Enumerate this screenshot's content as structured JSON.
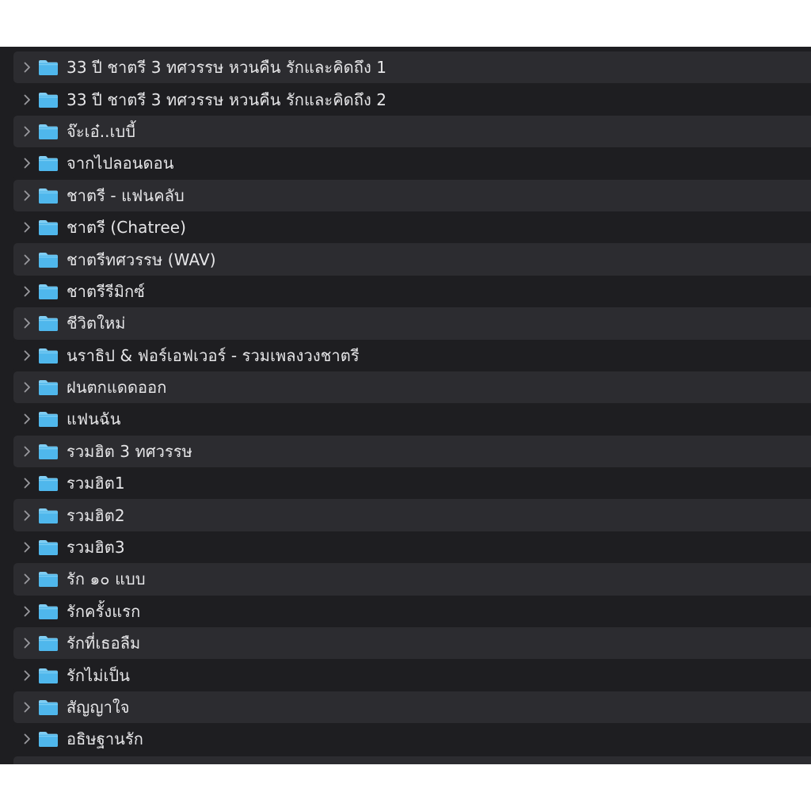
{
  "colors": {
    "window_bg": "#1e1e21",
    "row_alt_bg": "#2c2c30",
    "text": "#e6e6e8",
    "chevron": "#9a9a9f",
    "folder_body": "#4fb7ec",
    "folder_tab": "#7fcdf3"
  },
  "icons": {
    "disclosure": "chevron-right-icon",
    "item": "folder-icon"
  },
  "folders": [
    {
      "name": "33 ปี ชาตรี 3 ทศวรรษ หวนคืน รักและคิดถึง 1"
    },
    {
      "name": "33 ปี ชาตรี 3 ทศวรรษ หวนคืน รักและคิดถึง 2"
    },
    {
      "name": "จ๊ะเอ๋..เบบี้"
    },
    {
      "name": "จากไปลอนดอน"
    },
    {
      "name": "ชาตรี - แฟนคลับ"
    },
    {
      "name": "ชาตรี (Chatree)"
    },
    {
      "name": "ชาตรีทศวรรษ (WAV)"
    },
    {
      "name": "ชาตรีรีมิกซ์"
    },
    {
      "name": "ชีวิตใหม่"
    },
    {
      "name": "นราธิป & ฟอร์เอฟเวอร์ - รวมเพลงวงชาตรี"
    },
    {
      "name": "ฝนตกแดดออก"
    },
    {
      "name": "แฟนฉัน"
    },
    {
      "name": "รวมฮิต 3 ทศวรรษ"
    },
    {
      "name": "รวมฮิต1"
    },
    {
      "name": "รวมฮิต2"
    },
    {
      "name": "รวมฮิต3"
    },
    {
      "name": "รัก ๑๐ แบบ"
    },
    {
      "name": "รักครั้งแรก"
    },
    {
      "name": "รักที่เธอลืม"
    },
    {
      "name": "รักไม่เป็น"
    },
    {
      "name": "สัญญาใจ"
    },
    {
      "name": "อธิษฐานรัก"
    }
  ]
}
